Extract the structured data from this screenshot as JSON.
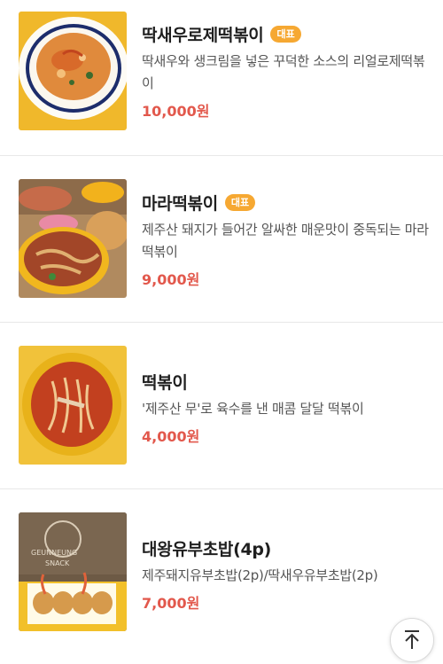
{
  "menu": {
    "items": [
      {
        "name": "딱새우로제떡볶이",
        "badge": "대표",
        "description": "딱새우와 생크림을 넣은 꾸덕한 소스의 리얼로제떡볶이",
        "price": "10,000원",
        "image": "rose-tteokbokki-photo"
      },
      {
        "name": "마라떡볶이",
        "badge": "대표",
        "description": "제주산 돼지가 들어간 알싸한 매운맛이 중독되는 마라떡볶이",
        "price": "9,000원",
        "image": "mala-tteokbokki-photo"
      },
      {
        "name": "떡볶이",
        "badge": "",
        "description": "'제주산 무'로 육수를 낸 매콤 달달 떡볶이",
        "price": "4,000원",
        "image": "tteokbokki-photo"
      },
      {
        "name": "대왕유부초밥(4p)",
        "badge": "",
        "description": "제주돼지유부초밥(2p)/딱새우유부초밥(2p)",
        "price": "7,000원",
        "image": "yubu-chobap-photo"
      }
    ]
  },
  "scroll_top_icon": "arrow-up-icon",
  "colors": {
    "price": "#e2584c",
    "badge": "#f6a832",
    "divider": "#e8e8e8"
  }
}
